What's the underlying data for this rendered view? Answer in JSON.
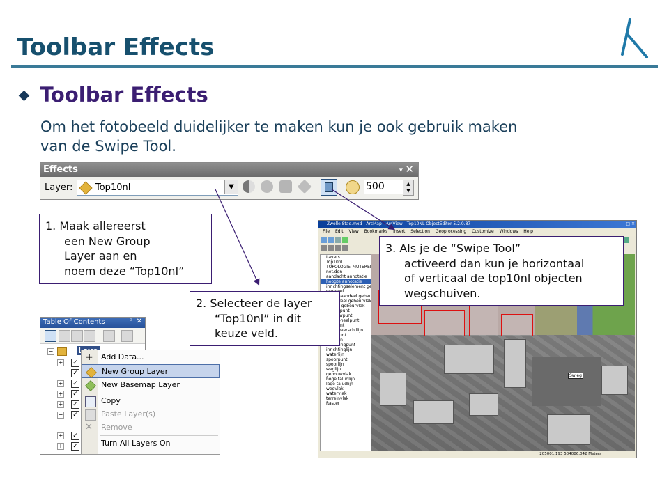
{
  "slide": {
    "title": "Toolbar Effects",
    "section_heading": "Toolbar Effects",
    "intro_lines": [
      "Om het fotobeeld duidelijker te maken kun je ook gebruik maken",
      "van de Swipe Tool."
    ]
  },
  "effects_toolbar": {
    "title": "Effects",
    "minimize": "▾",
    "close": "✕",
    "layer_label": "Layer:",
    "layer_value": "Top10nl",
    "flicker_rate": "500"
  },
  "callouts": {
    "step1": [
      "1. Maak allereerst",
      "een New Group",
      "Layer aan en",
      "noem deze “Top10nl”"
    ],
    "step2": [
      "2. Selecteer de layer",
      "“Top10nl” in dit",
      "keuze veld."
    ],
    "step3": [
      "3. Als je de “Swipe Tool”",
      "activeerd dan kun je horizontaal",
      "of verticaal de top10nl objecten",
      "wegschuiven."
    ]
  },
  "toc": {
    "title": "Table Of Contents",
    "pin": "ᵖ",
    "close": "✕",
    "layers_label": "Laye"
  },
  "context_menu": {
    "items": [
      {
        "label": "Add Data...",
        "disabled": false
      },
      {
        "label": "New Group Layer",
        "disabled": false,
        "selected": true
      },
      {
        "label": "New Basemap Layer",
        "disabled": false
      },
      {
        "label": "Copy",
        "disabled": false
      },
      {
        "label": "Paste Layer(s)",
        "disabled": true
      },
      {
        "label": "Remove",
        "disabled": true
      },
      {
        "label": "Turn All Layers On",
        "disabled": false
      }
    ]
  },
  "arcmap": {
    "title": "Zwolle Stad.mxd - ArcMap - ArcView - Top10NL ObjectEditor 5.2.0.87",
    "window_buttons": "_ □ ✕",
    "menus": [
      "File",
      "Edit",
      "View",
      "Bookmarks",
      "Insert",
      "Selection",
      "Geoprocessing",
      "Customize",
      "Windows",
      "Help"
    ],
    "toc_items": [
      "Layers",
      "Top10nl",
      "TOPOLOGIE_MUTEREN",
      "net.dgn",
      "aandacht annotatie",
      "hoogte annotatie",
      "inrichtingselement gebeurpunt",
      "wegdeel",
      "",
      "spoorbaandeel gebeurvlak",
      "waterdeel gebeurvlak",
      "terrein gebeurvlak",
      "terreinpunt",
      "gebouwpunt",
      "functioneelpunt",
      "wegpunt",
      "hoogteverschillijn",
      "reliefpunt",
      "relieflijn",
      "inrichtingpunt",
      "inrichtinglijn",
      "waterlijn",
      "spoorpunt",
      "spoorlijn",
      "weglijn",
      "gebouwvlak",
      "hoge taludlijn",
      "lage taludlijn",
      "wegvlak",
      "watervlak",
      "terreinvlak",
      "Raster"
    ],
    "map_tag": "Swieg",
    "status": "205001,193  504086,042 Meters"
  }
}
